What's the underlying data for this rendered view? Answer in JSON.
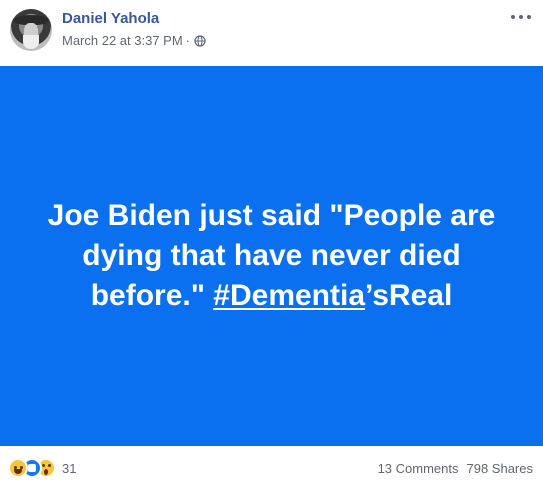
{
  "post": {
    "author": "Daniel Yahola",
    "timestamp": "March 22 at 3:37 PM",
    "separator": "·",
    "privacy_icon": "globe-icon",
    "text_main": "Joe Biden just said \"People are dying that have never died before.\" ",
    "hashtag": "#Dementia",
    "text_tail": "’sReal",
    "background_color": "#0b70f0"
  },
  "footer": {
    "reaction_icons": [
      "haha-icon",
      "like-icon",
      "wow-icon"
    ],
    "reaction_count": "31",
    "comments": "13 Comments",
    "shares": "798 Shares"
  }
}
